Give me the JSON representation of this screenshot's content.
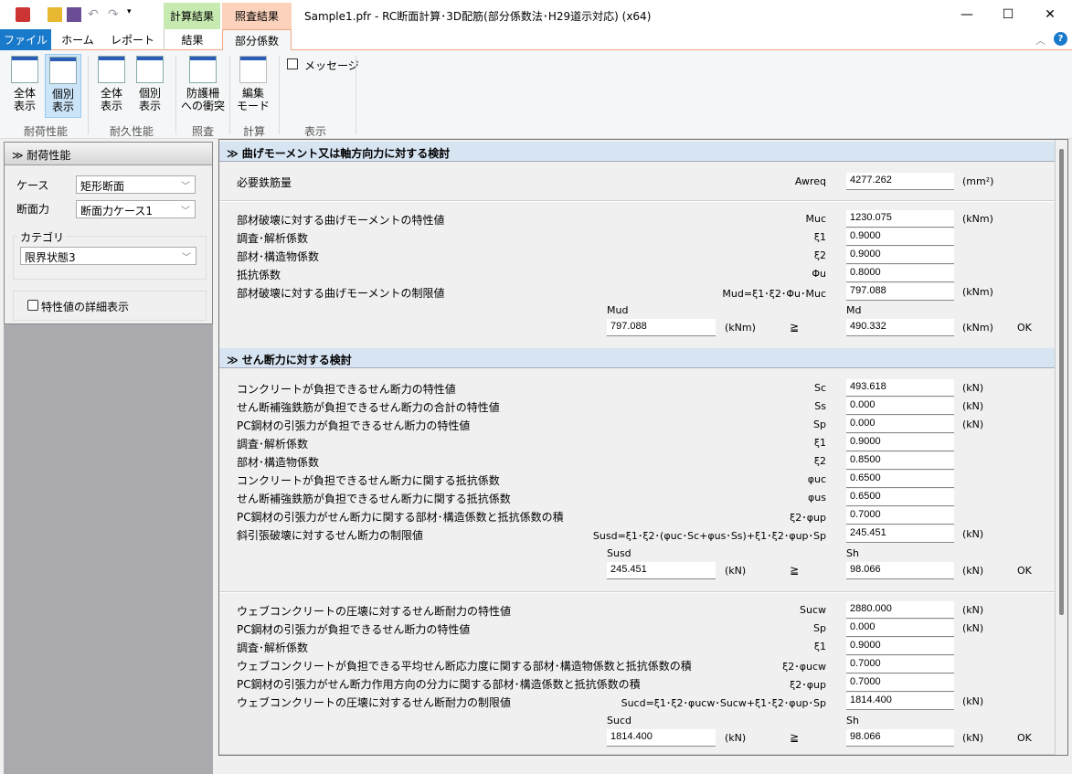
{
  "window": {
    "title": "Sample1.pfr - RC断面計算･3D配筋(部分係数法･H29道示対応) (x64)",
    "minimize": "—",
    "maximize": "☐",
    "close": "✕"
  },
  "context_tabs": {
    "calc": "計算結果",
    "check": "照査結果"
  },
  "tabs": [
    {
      "label": "ファイル"
    },
    {
      "label": "ホーム"
    },
    {
      "label": "レポート"
    },
    {
      "label": "結果"
    },
    {
      "label": "部分係数"
    }
  ],
  "ribbon": {
    "buttons": [
      {
        "label1": "全体",
        "label2": "表示"
      },
      {
        "label1": "個別",
        "label2": "表示"
      },
      {
        "label1": "全体",
        "label2": "表示"
      },
      {
        "label1": "個別",
        "label2": "表示"
      },
      {
        "label1": "防護柵",
        "label2": "への衝突"
      },
      {
        "label1": "編集",
        "label2": "モード"
      }
    ],
    "message_checkbox": "メッセージ",
    "groups": [
      "耐荷性能",
      "耐久性能",
      "照査",
      "計算",
      "表示"
    ]
  },
  "left": {
    "header": "耐荷性能",
    "case_label": "ケース",
    "case_value": "矩形断面",
    "force_label": "断面力",
    "force_value": "断面力ケース1",
    "category_label": "カテゴリ",
    "category_value": "限界状態3",
    "detail_checkbox": "特性値の詳細表示"
  },
  "sections": [
    {
      "title": "曲げモーメント又は軸方向力に対する検討"
    },
    {
      "title": "せん断力に対する検討"
    }
  ],
  "rows1a": [
    {
      "label": "必要鉄筋量",
      "sym": "Awreq",
      "value": "4277.262",
      "unit": "(mm²)"
    }
  ],
  "rows1b": [
    {
      "label": "部材破壊に対する曲げモーメントの特性値",
      "sym": "Muc",
      "value": "1230.075",
      "unit": "(kNm)"
    },
    {
      "label": "調査･解析係数",
      "sym": "ξ1",
      "value": "0.9000",
      "unit": ""
    },
    {
      "label": "部材･構造物係数",
      "sym": "ξ2",
      "value": "0.9000",
      "unit": ""
    },
    {
      "label": "抵抗係数",
      "sym": "Φu",
      "value": "0.8000",
      "unit": ""
    },
    {
      "label": "部材破壊に対する曲げモーメントの制限値",
      "sym": "Mud=ξ1･ξ2･Φu･Muc",
      "value": "797.088",
      "unit": "(kNm)"
    }
  ],
  "cmp1": {
    "left_label": "Mud",
    "left_value": "797.088",
    "left_unit": "(kNm)",
    "op": "≧",
    "right_label": "Md",
    "right_value": "490.332",
    "right_unit": "(kNm)",
    "result": "OK"
  },
  "rows2a": [
    {
      "label": "コンクリートが負担できるせん断力の特性値",
      "sym": "Sc",
      "value": "493.618",
      "unit": "(kN)"
    },
    {
      "label": "せん断補強鉄筋が負担できるせん断力の合計の特性値",
      "sym": "Ss",
      "value": "0.000",
      "unit": "(kN)"
    },
    {
      "label": "PC鋼材の引張力が負担できるせん断力の特性値",
      "sym": "Sp",
      "value": "0.000",
      "unit": "(kN)"
    },
    {
      "label": "調査･解析係数",
      "sym": "ξ1",
      "value": "0.9000",
      "unit": ""
    },
    {
      "label": "部材･構造物係数",
      "sym": "ξ2",
      "value": "0.8500",
      "unit": ""
    },
    {
      "label": "コンクリートが負担できるせん断力に関する抵抗係数",
      "sym": "φuc",
      "value": "0.6500",
      "unit": ""
    },
    {
      "label": "せん断補強鉄筋が負担できるせん断力に関する抵抗係数",
      "sym": "φus",
      "value": "0.6500",
      "unit": ""
    },
    {
      "label": "PC鋼材の引張力がせん断力に関する部材･構造係数と抵抗係数の積",
      "sym": "ξ2･φup",
      "value": "0.7000",
      "unit": ""
    },
    {
      "label": "斜引張破壊に対するせん断力の制限値",
      "sym": "Susd=ξ1･ξ2･(φuc･Sc+φus･Ss)+ξ1･ξ2･φup･Sp",
      "value": "245.451",
      "unit": "(kN)"
    }
  ],
  "cmp2": {
    "left_label": "Susd",
    "left_value": "245.451",
    "left_unit": "(kN)",
    "op": "≧",
    "right_label": "Sh",
    "right_value": "98.066",
    "right_unit": "(kN)",
    "result": "OK"
  },
  "rows2b": [
    {
      "label": "ウェブコンクリートの圧壊に対するせん断耐力の特性値",
      "sym": "Sucw",
      "value": "2880.000",
      "unit": "(kN)"
    },
    {
      "label": "PC鋼材の引張力が負担できるせん断力の特性値",
      "sym": "Sp",
      "value": "0.000",
      "unit": "(kN)"
    },
    {
      "label": "調査･解析係数",
      "sym": "ξ1",
      "value": "0.9000",
      "unit": ""
    },
    {
      "label": "ウェブコンクリートが負担できる平均せん断応力度に関する部材･構造物係数と抵抗係数の積",
      "sym": "ξ2･φucw",
      "value": "0.7000",
      "unit": ""
    },
    {
      "label": "PC鋼材の引張力がせん断力作用方向の分力に関する部材･構造係数と抵抗係数の積",
      "sym": "ξ2･φup",
      "value": "0.7000",
      "unit": ""
    },
    {
      "label": "ウェブコンクリートの圧壊に対するせん断耐力の制限値",
      "sym": "Sucd=ξ1･ξ2･φucw･Sucw+ξ1･ξ2･φup･Sp",
      "value": "1814.400",
      "unit": "(kN)"
    }
  ],
  "cmp3": {
    "left_label": "Sucd",
    "left_value": "1814.400",
    "left_unit": "(kN)",
    "op": "≧",
    "right_label": "Sh",
    "right_value": "98.066",
    "right_unit": "(kN)",
    "result": "OK"
  },
  "colors": {
    "file_tab": "#1979ca",
    "calc_tab": "#c6eab0",
    "check_tab": "#fcd2bc",
    "section_header": "#d7e4f2"
  }
}
